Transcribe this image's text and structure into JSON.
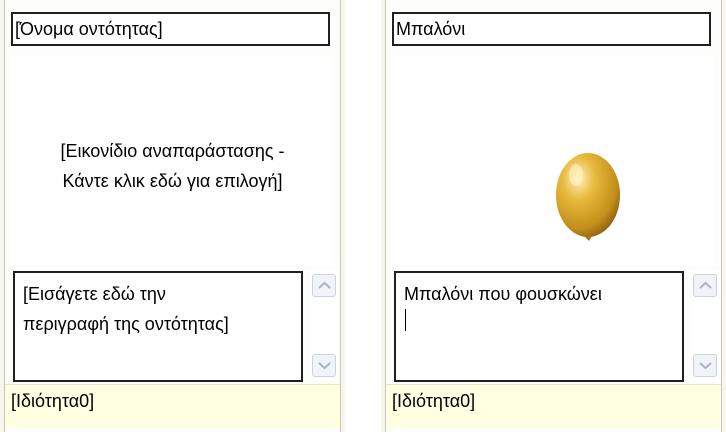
{
  "left_panel": {
    "name_field": "[Όνομα οντότητας]",
    "icon_placeholder_line1": "[Εικονίδιο αναπαράστασης -",
    "icon_placeholder_line2": "Κάντε κλικ εδώ για επιλογή]",
    "description_line1": "[Εισάγετε εδώ την",
    "description_line2": "περιγραφή της οντότητας]",
    "property": "[Ιδιότητα0]"
  },
  "right_panel": {
    "name_field": "Μπαλόνι",
    "icon": "gold-balloon",
    "description": "Μπαλόνι που φουσκώνει",
    "property": "[Ιδιότητα0]"
  },
  "colors": {
    "balloon": "#d4a024",
    "property_bar": "#ffffe1"
  }
}
